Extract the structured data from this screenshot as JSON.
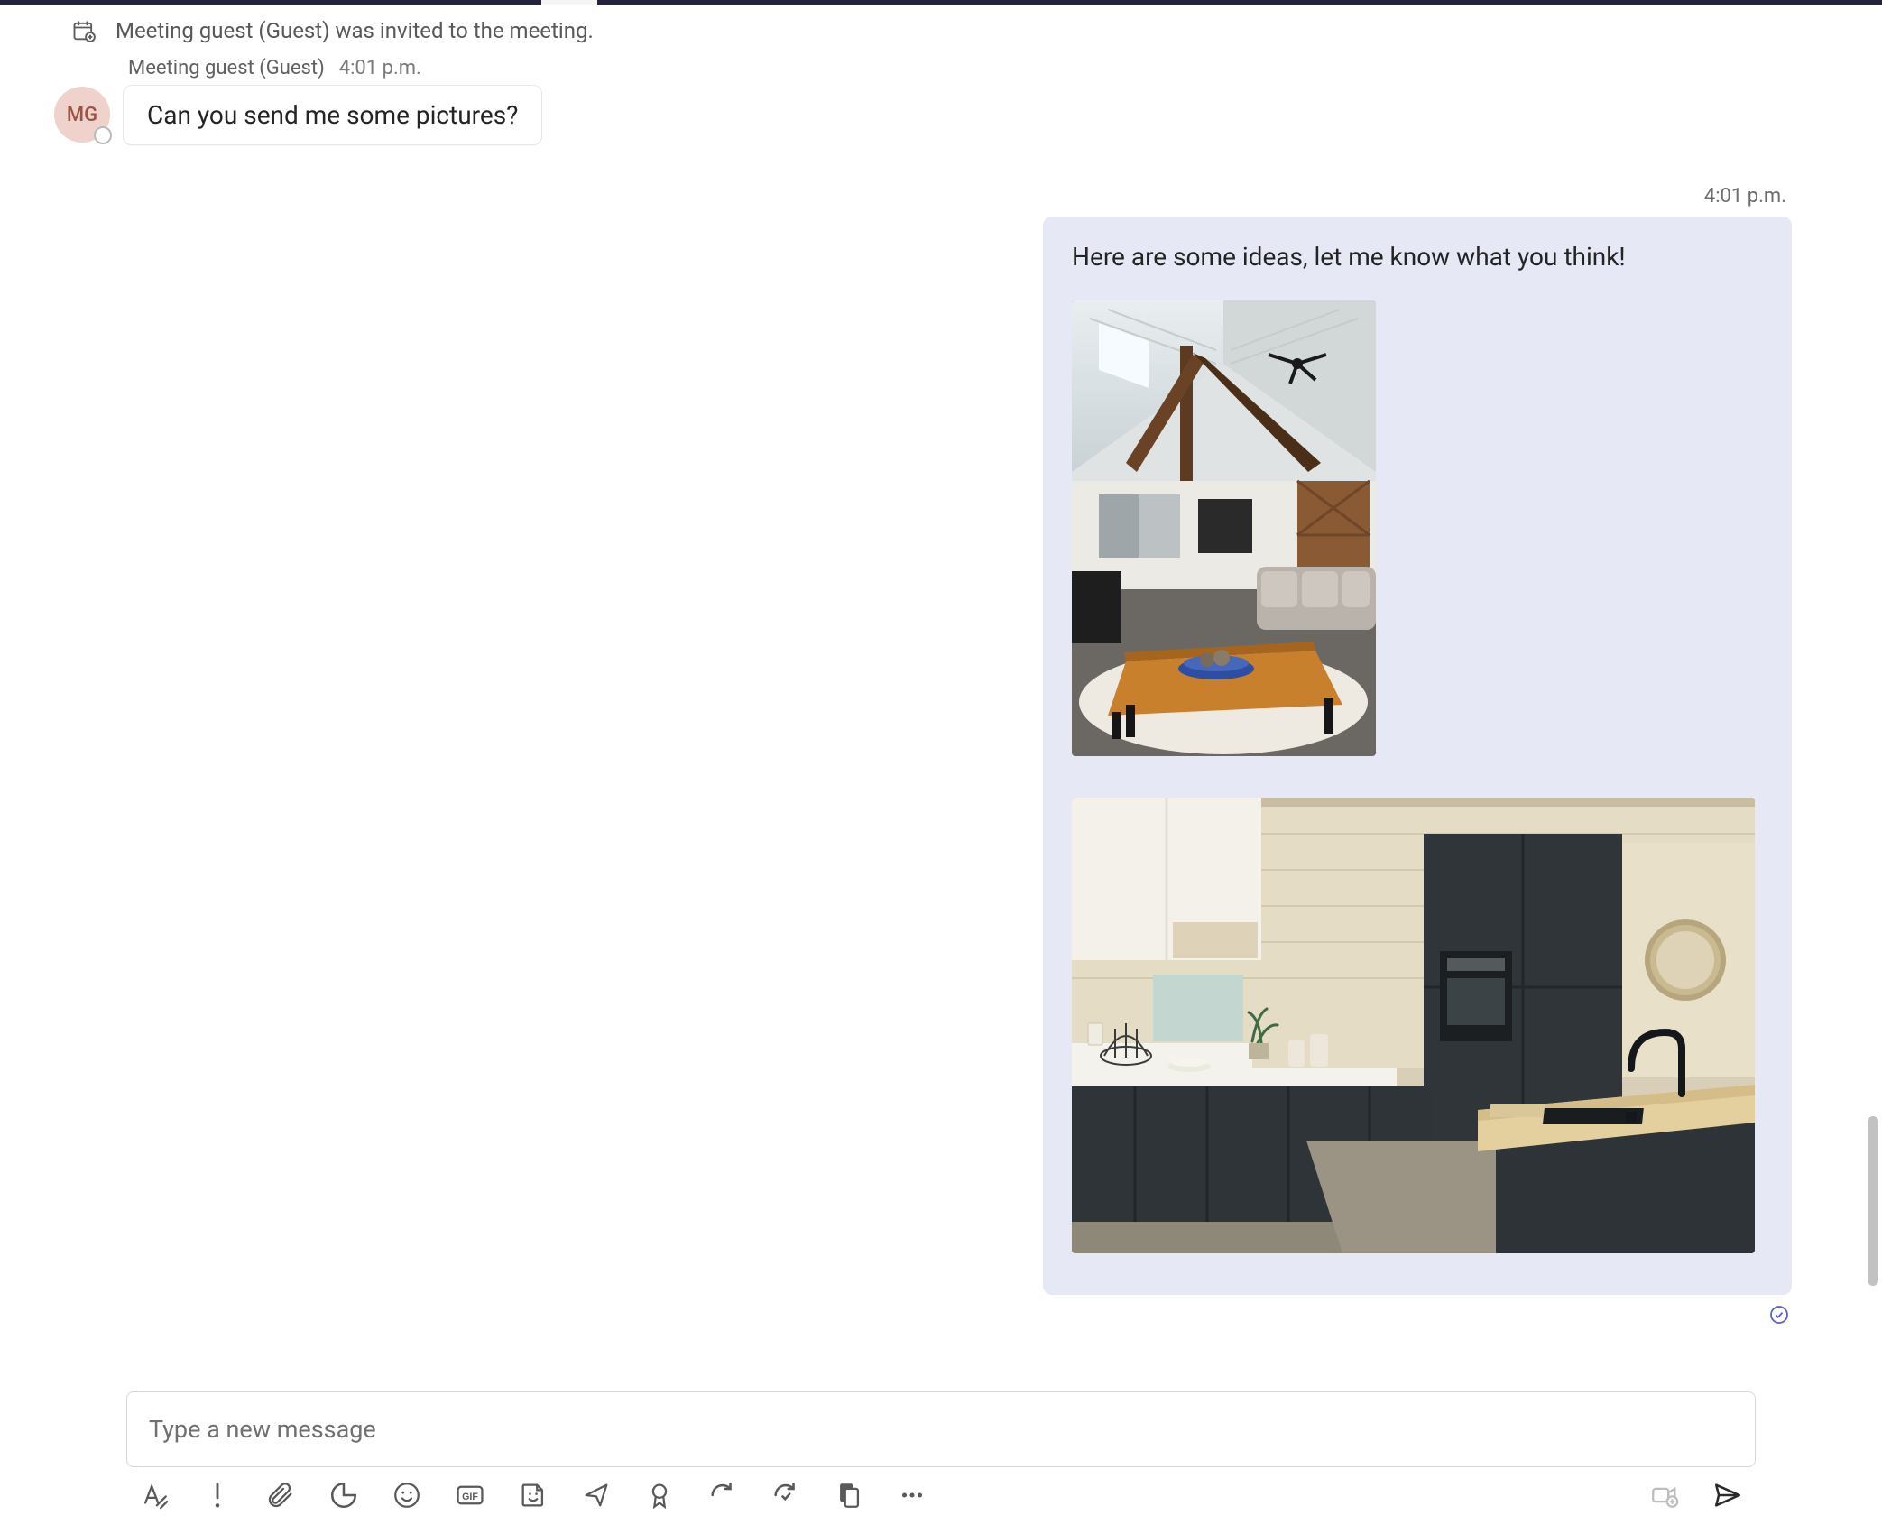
{
  "system_event": {
    "icon": "calendar-add-icon",
    "text": "Meeting guest (Guest) was invited to the meeting."
  },
  "incoming": {
    "sender_name": "Meeting guest (Guest)",
    "timestamp": "4:01 p.m.",
    "avatar_initials": "MG",
    "message_text": "Can you send me some pictures?"
  },
  "outgoing": {
    "timestamp": "4:01 p.m.",
    "message_text": "Here are some ideas, let me know what you think!",
    "attachments": [
      {
        "name": "interior-living-room-photo"
      },
      {
        "name": "kitchen-photo"
      }
    ],
    "read_receipt": true
  },
  "composer": {
    "placeholder": "Type a new message"
  },
  "toolbar_icons": [
    "format-text-icon",
    "priority-icon",
    "attach-file-icon",
    "loop-component-icon",
    "emoji-icon",
    "gif-icon",
    "sticker-icon",
    "share-icon",
    "ribbon-icon",
    "refresh-icon",
    "refresh-tick-icon",
    "copy-icon",
    "more-options-icon"
  ],
  "right_icons": [
    "video-clip-icon",
    "send-icon"
  ]
}
